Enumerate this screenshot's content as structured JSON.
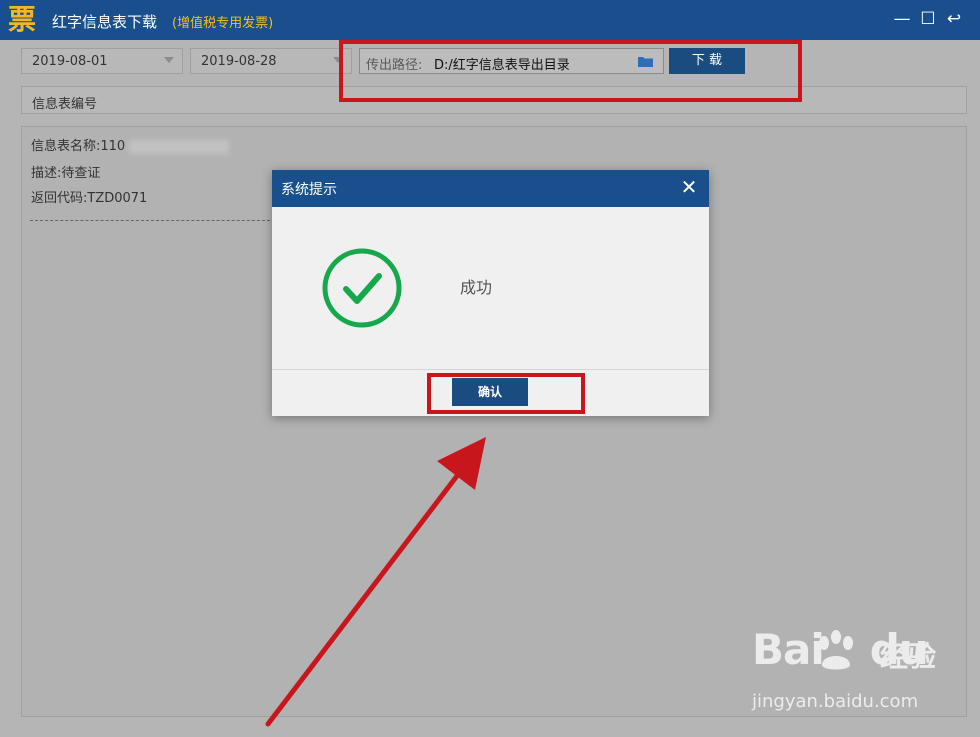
{
  "app": {
    "logo_char": "票",
    "title": "红字信息表下载",
    "subtitle": "(增值税专用发票)"
  },
  "window_controls": {
    "minimize": "—",
    "maximize": "☐",
    "restore": "↩"
  },
  "toolbar": {
    "start_date": "2019-08-01",
    "end_date": "2019-08-28",
    "path_label": "传出路径:",
    "path_value": "D:/红字信息表导出目录",
    "download_label": "下 载"
  },
  "info_number": {
    "label": "信息表编号"
  },
  "details": {
    "name_label": "信息表名称:",
    "name_value": "110",
    "desc_label": "描述:",
    "desc_value": "待查证",
    "code_label": "返回代码:",
    "code_value": "TZD0071"
  },
  "dialog": {
    "title": "系统提示",
    "close": "✕",
    "message": "成功",
    "ok_label": "确认",
    "icon": "check-circle-icon"
  },
  "watermark": {
    "brand": "Bai",
    "brand2": "du",
    "suffix": "经验",
    "url": "jingyan.baidu.com"
  },
  "colors": {
    "titlebar": "#1a4f8d",
    "button": "#1a4c80",
    "success": "#17a84b",
    "annotation": "#c8161d",
    "subtitle": "#f0c020"
  }
}
